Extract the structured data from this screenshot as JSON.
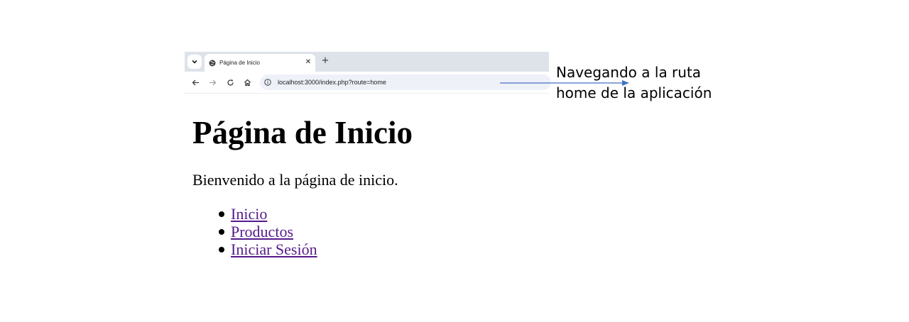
{
  "browser": {
    "tab": {
      "title": "Página de Inicio",
      "favicon": "globe-icon",
      "close_glyph": "✕"
    },
    "new_tab_glyph": "+",
    "toolbar": {
      "back_icon": "back-arrow-icon",
      "forward_icon": "forward-arrow-icon",
      "reload_icon": "reload-icon",
      "home_icon": "home-icon"
    },
    "url": "localhost:3000/index.php?route=home"
  },
  "page": {
    "heading": "Página de Inicio",
    "intro": "Bienvenido a la página de inicio.",
    "links": [
      {
        "label": "Inicio"
      },
      {
        "label": "Productos"
      },
      {
        "label": "Iniciar Sesión"
      }
    ],
    "link_color": "#551a8b"
  },
  "annotation": {
    "line1": "Navegando a la ruta",
    "line2": "home de la aplicación",
    "arrow_color": "#4472c4"
  }
}
